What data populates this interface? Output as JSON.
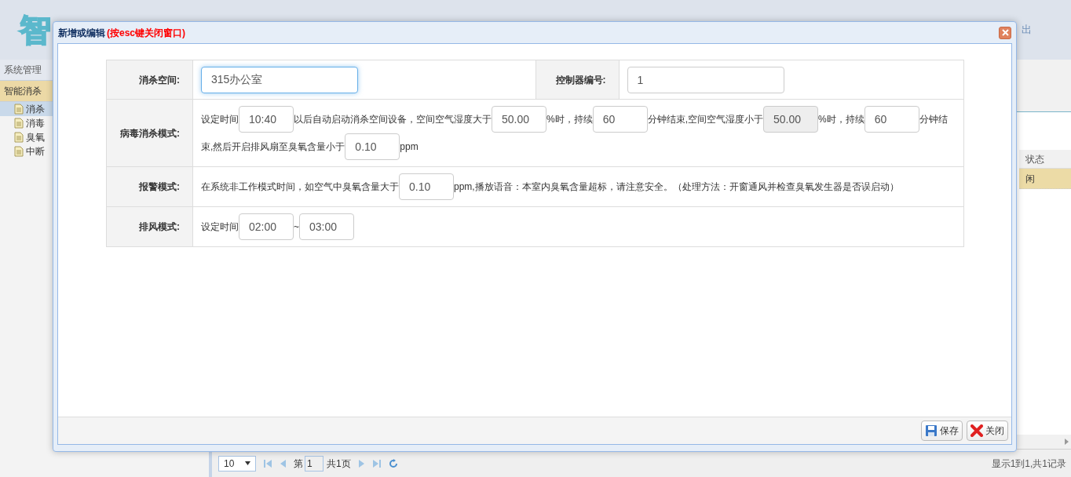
{
  "app": {
    "logo": "智",
    "logout": "出",
    "sidebar": [
      {
        "label": "系统管理",
        "selected": false
      },
      {
        "label": "智能消杀",
        "selected": true
      }
    ],
    "tree": [
      {
        "label": "消杀",
        "selected": true
      },
      {
        "label": "消毒",
        "selected": false
      },
      {
        "label": "臭氧",
        "selected": false
      },
      {
        "label": "中断",
        "selected": false
      }
    ],
    "grid": {
      "column": "状态",
      "rows": [
        {
          "cell": "闲",
          "selected": true
        }
      ]
    },
    "pager": {
      "page_size": "10",
      "page_prefix": "第",
      "page": "1",
      "page_total": "共1页",
      "summary": "显示1到1,共1记录"
    }
  },
  "dialog": {
    "title": "新增或编辑",
    "hint": "(按esc键关闭窗口)",
    "rows": [
      {
        "kind": "pairs",
        "pairs": [
          {
            "label": "消杀空间:",
            "value": "315办公室",
            "focused": true
          },
          {
            "label": "控制器编号:",
            "value": "1",
            "focused": false
          }
        ]
      },
      {
        "kind": "mixed",
        "label": "病毒消杀模式:",
        "lines": [
          [
            {
              "kind": "text",
              "text": "设定时间"
            },
            {
              "kind": "field",
              "value": "10:40",
              "disabled": false
            },
            {
              "kind": "text",
              "text": "以后自动启动消杀空间设备，空间空气湿度大于"
            },
            {
              "kind": "field",
              "value": "50.00",
              "disabled": false
            },
            {
              "kind": "text",
              "text": "%时，持续"
            },
            {
              "kind": "field",
              "value": "60",
              "disabled": false
            },
            {
              "kind": "text",
              "text": "分钟结束,空间空气湿度小于"
            },
            {
              "kind": "field",
              "value": "50.00",
              "disabled": true
            },
            {
              "kind": "text",
              "text": "%时，持续"
            },
            {
              "kind": "field",
              "value": "60",
              "disabled": false
            },
            {
              "kind": "text",
              "text": "分钟结"
            }
          ],
          [
            {
              "kind": "text",
              "text": "束,然后开启排风扇至臭氧含量小于"
            },
            {
              "kind": "field",
              "value": "0.10",
              "disabled": false
            },
            {
              "kind": "text",
              "text": "ppm"
            }
          ]
        ]
      },
      {
        "kind": "mixed",
        "label": "报警模式:",
        "lines": [
          [
            {
              "kind": "text",
              "text": "在系统非工作模式时间，如空气中臭氧含量大于"
            },
            {
              "kind": "field",
              "value": "0.10",
              "disabled": false
            },
            {
              "kind": "text",
              "text": "ppm,播放语音：本室内臭氧含量超标，请注意安全。（处理方法：开窗通风并检查臭氧发生器是否误启动）"
            }
          ]
        ]
      },
      {
        "kind": "mixed",
        "label": "排风模式:",
        "lines": [
          [
            {
              "kind": "text",
              "text": "设定时间"
            },
            {
              "kind": "field",
              "value": "02:00",
              "disabled": false
            },
            {
              "kind": "text",
              "text": "~"
            },
            {
              "kind": "field",
              "value": "03:00",
              "disabled": false
            }
          ]
        ]
      }
    ],
    "buttons": [
      {
        "kind": "save",
        "label": "保存"
      },
      {
        "kind": "close",
        "label": "关闭"
      }
    ]
  }
}
